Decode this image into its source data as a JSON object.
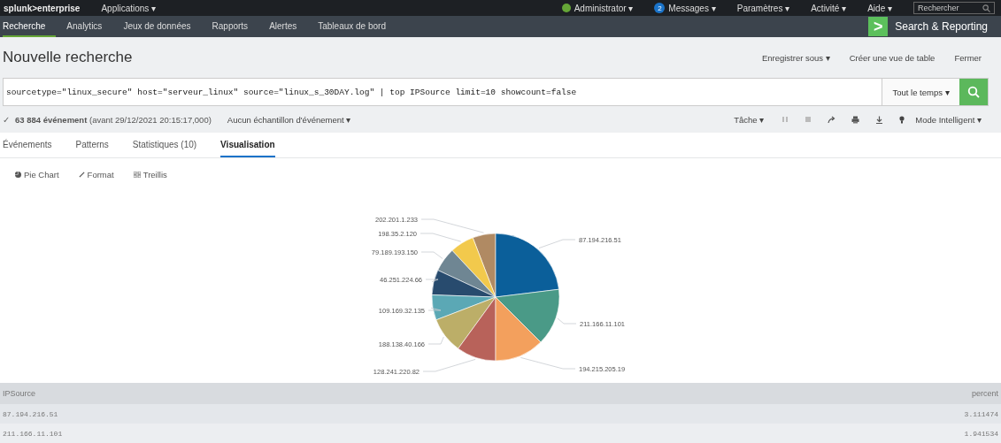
{
  "top_bar": {
    "logo": "splunk>enterprise",
    "apps_menu": "Applications ▾",
    "menus": [
      {
        "label": "Administrator ▾",
        "kind": "user"
      },
      {
        "label": "Messages ▾",
        "badge": "2",
        "kind": "messages"
      },
      {
        "label": "Paramètres ▾",
        "kind": "plain"
      },
      {
        "label": "Activité ▾",
        "kind": "plain"
      },
      {
        "label": "Aide ▾",
        "kind": "plain"
      }
    ],
    "search": {
      "placeholder": "Rechercher"
    }
  },
  "nav": {
    "tabs": [
      {
        "label": "Recherche",
        "selected": true
      },
      {
        "label": "Analytics",
        "selected": false
      },
      {
        "label": "Jeux de données",
        "selected": false
      },
      {
        "label": "Rapports",
        "selected": false
      },
      {
        "label": "Alertes",
        "selected": false
      },
      {
        "label": "Tableaux de bord",
        "selected": false
      }
    ],
    "app_logo": ">",
    "app_name": "Search & Reporting"
  },
  "page": {
    "title": "Nouvelle recherche",
    "actions": [
      "Enregistrer sous ▾",
      "Créer une vue de table",
      "Fermer"
    ]
  },
  "search_bar": {
    "query": "sourcetype=\"linux_secure\" host=\"serveur_linux\"  source=\"linux_s_30DAY.log\" | top IPSource limit=10 showcount=false",
    "time_range": "Tout le temps ▾"
  },
  "status": {
    "check": "✓",
    "count": "**63 884 événement** (avant 29/12/2021 20:15:17,000)",
    "sampling": "Aucun échantillon d'événement ▾",
    "job": "Tâche ▾",
    "mode": "Mode Intelligent ▾"
  },
  "result_tabs": [
    {
      "label": "Événements",
      "selected": false
    },
    {
      "label": "Patterns",
      "selected": false
    },
    {
      "label": "Statistiques (10)",
      "selected": false
    },
    {
      "label": "Visualisation",
      "selected": true
    }
  ],
  "viz_controls": [
    {
      "label": "Pie Chart",
      "kind": "pie"
    },
    {
      "label": "Format",
      "kind": "format"
    },
    {
      "label": "Treillis",
      "kind": "trellis"
    }
  ],
  "pie_labels": [
    "202.201.1.233",
    "198.35.2.120",
    "79.189.193.150",
    "46.251.224.66",
    "109.169.32.135",
    "188.138.40.166",
    "128.241.220.82",
    "87.194.216.51",
    "211.166.11.101",
    "194.215.205.19"
  ],
  "table": {
    "columns": [
      "IPSource",
      "percent"
    ],
    "rows": [
      [
        "87.194.216.51",
        "3.111474"
      ],
      [
        "211.166.11.101",
        "1.941534"
      ]
    ]
  }
}
